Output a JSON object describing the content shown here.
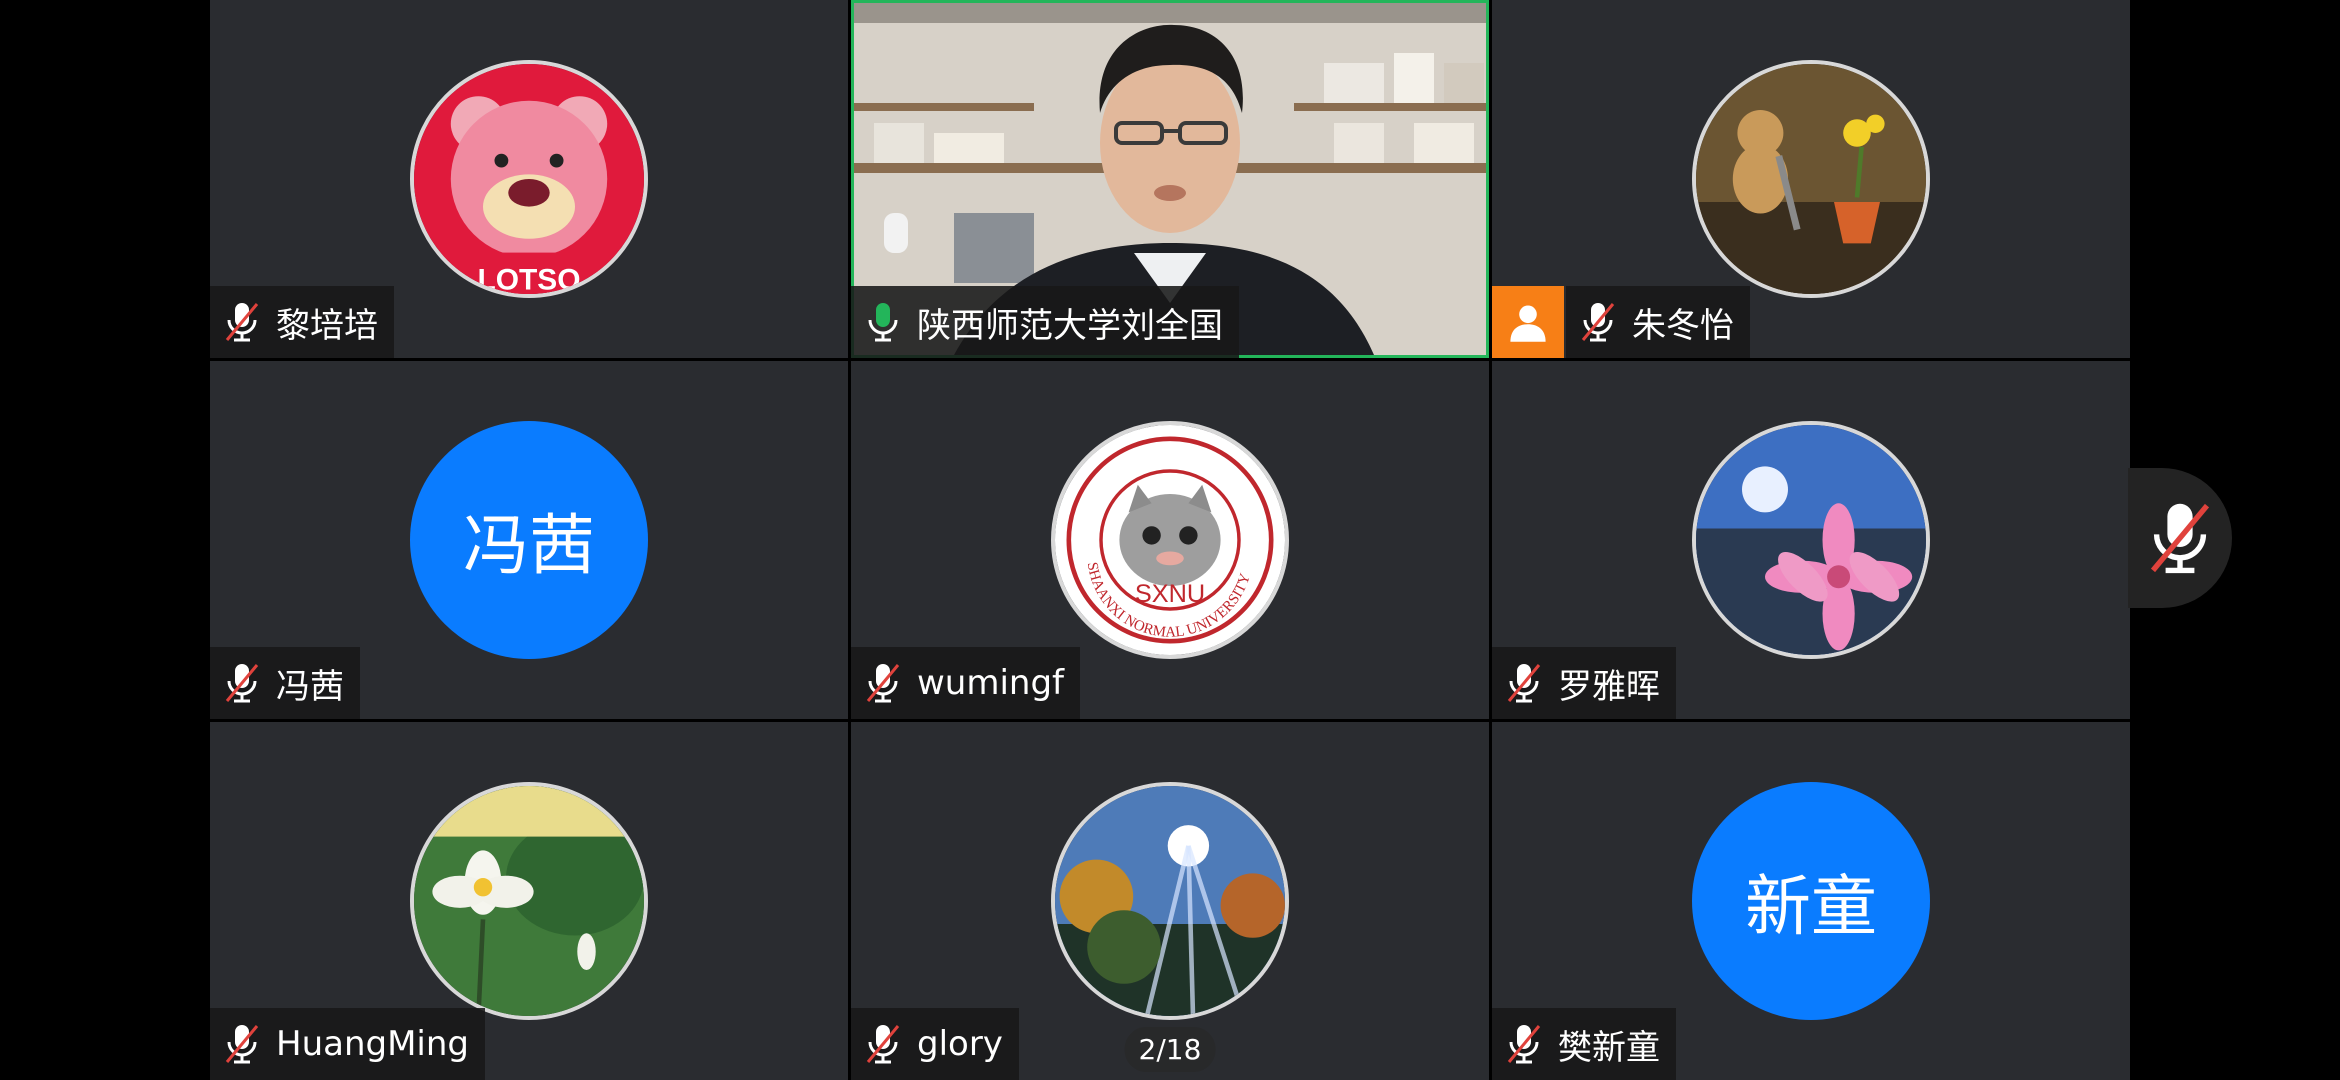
{
  "colors": {
    "tile_bg": "#2a2c30",
    "active_border": "#23b55a",
    "avatar_blue": "#0a7cff",
    "person_badge": "#f77f16",
    "mic_muted_slash": "#e0423c",
    "mic_active": "#23b55a"
  },
  "participants": [
    {
      "name": "黎培培",
      "mic": "muted",
      "avatar": "image"
    },
    {
      "name": "陕西师范大学刘全国",
      "mic": "active",
      "avatar": "video",
      "speaking": true
    },
    {
      "name": "朱冬怡",
      "mic": "muted",
      "avatar": "image",
      "badge": "person-icon"
    },
    {
      "name": "冯茜",
      "mic": "muted",
      "avatar": "text",
      "avatar_text": "冯茜"
    },
    {
      "name": "wumingf",
      "mic": "muted",
      "avatar": "image",
      "logo_text": "SXNU"
    },
    {
      "name": "罗雅晖",
      "mic": "muted",
      "avatar": "image"
    },
    {
      "name": "HuangMing",
      "mic": "muted",
      "avatar": "image"
    },
    {
      "name": "glory",
      "mic": "muted",
      "avatar": "image"
    },
    {
      "name": "樊新童",
      "mic": "muted",
      "avatar": "text",
      "avatar_text": "新童"
    }
  ],
  "pager": {
    "text": "2/18"
  },
  "floating_mic": {
    "state": "muted",
    "icon": "mic-off-icon"
  },
  "logo_ring_text": "SHAANXI NORMAL UNIVERSITY",
  "lotso_text": "LOTSO"
}
